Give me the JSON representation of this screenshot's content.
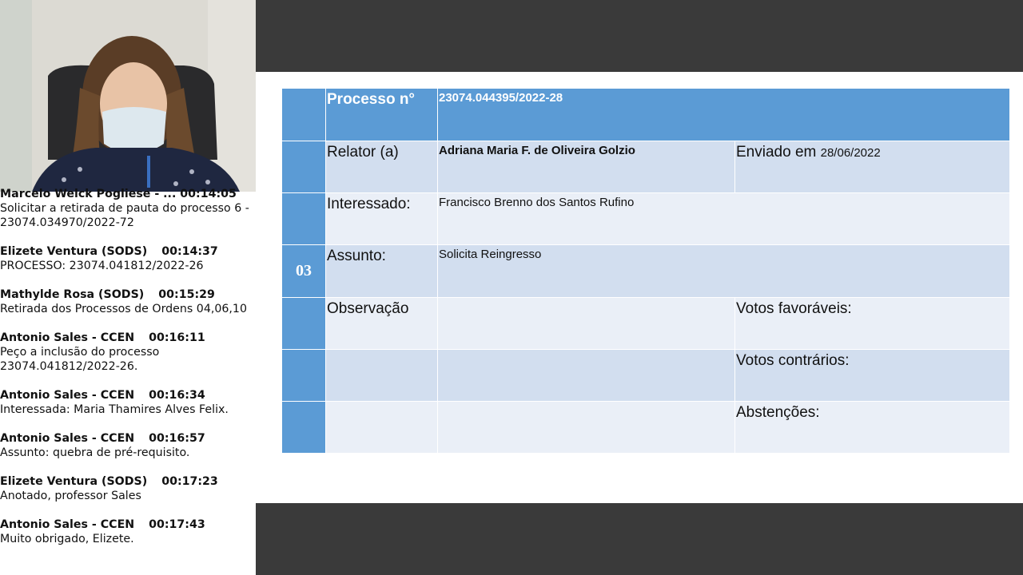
{
  "chat": {
    "messages": [
      {
        "sender": "Marcelo Welck Pogliese - ...",
        "time": "00:14:05",
        "text": "Solicitar a retirada de pauta do processo 6 - 23074.034970/2022-72"
      },
      {
        "sender": "Elizete Ventura (SODS)",
        "time": "00:14:37",
        "text": "PROCESSO: 23074.041812/2022-26"
      },
      {
        "sender": "Mathylde Rosa (SODS)",
        "time": "00:15:29",
        "text": "Retirada dos Processos de Ordens 04,06,10"
      },
      {
        "sender": "Antonio Sales - CCEN",
        "time": "00:16:11",
        "text": "Peço a inclusão do processo 23074.041812/2022-26."
      },
      {
        "sender": "Antonio Sales - CCEN",
        "time": "00:16:34",
        "text": "Interessada: Maria Thamires Alves Felix."
      },
      {
        "sender": "Antonio Sales - CCEN",
        "time": "00:16:57",
        "text": "Assunto: quebra de pré-requisito."
      },
      {
        "sender": "Elizete Ventura (SODS)",
        "time": "00:17:23",
        "text": "Anotado, professor Sales"
      },
      {
        "sender": "Antonio Sales - CCEN",
        "time": "00:17:43",
        "text": "Muito obrigado, Elizete."
      }
    ]
  },
  "slide": {
    "item_number": "03",
    "process_label": "Processo n°",
    "process_value": "23074.044395/2022-28",
    "relator_label": "Relator (a)",
    "relator_value": "Adriana Maria F. de Oliveira Golzio",
    "sent_label": "Enviado em",
    "sent_date": "28/06/2022",
    "interessado_label": "Interessado:",
    "interessado_value": "Francisco Brenno dos Santos Rufino",
    "assunto_label": "Assunto:",
    "assunto_value": "Solicita Reingresso",
    "observacao_label": "Observação",
    "votos_favoraveis_label": "Votos favoráveis:",
    "votos_contrarios_label": "Votos contrários:",
    "abstencoes_label": "Abstenções:"
  },
  "colors": {
    "table_header": "#5b9bd5",
    "row_dark": "#d2deef",
    "row_light": "#eaeff7",
    "screen_background": "#3a3a3a"
  }
}
